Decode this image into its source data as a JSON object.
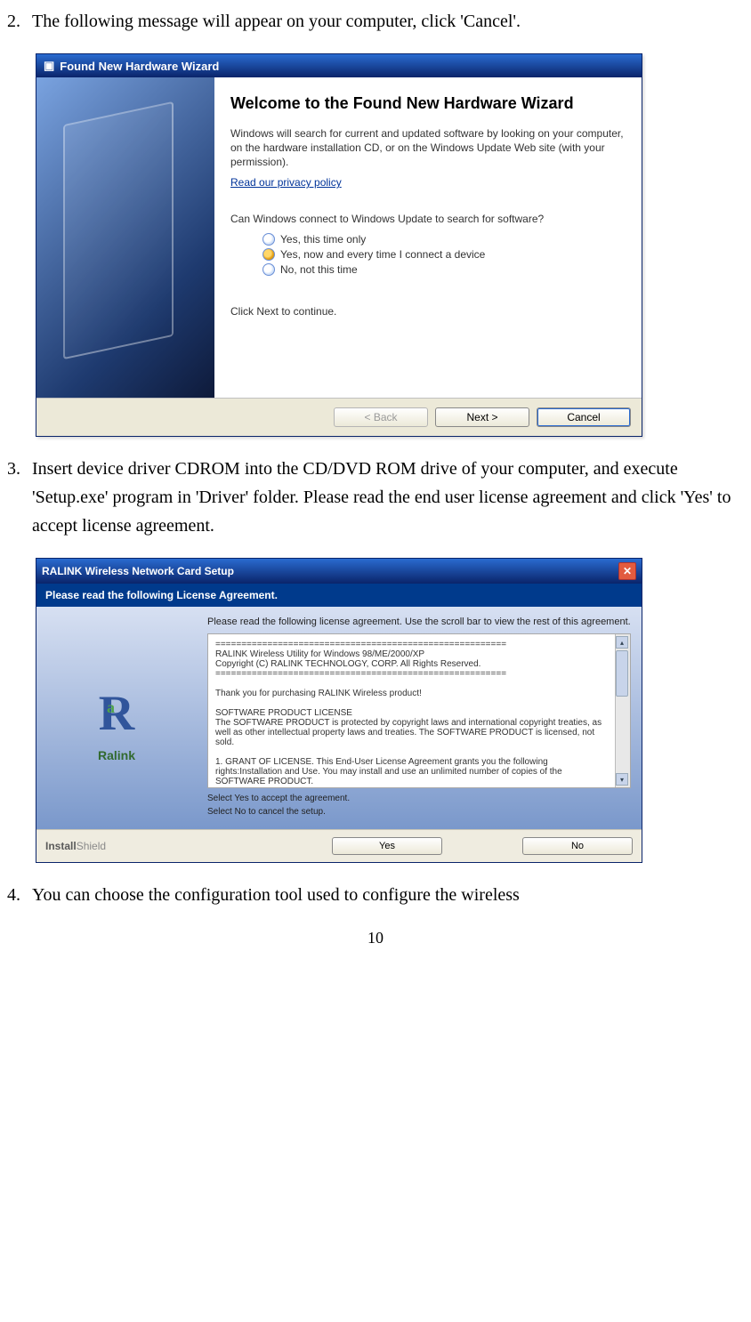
{
  "page_number": "10",
  "steps": {
    "s2": {
      "num": "2.",
      "text": "The following message will appear on your computer, click 'Cancel'."
    },
    "s3": {
      "num": "3.",
      "text": "Insert device driver CDROM into the CD/DVD ROM drive of your computer, and execute 'Setup.exe' program in 'Driver' folder. Please read the end user license agreement and click 'Yes' to accept license agreement."
    },
    "s4": {
      "num": "4.",
      "text": "You can choose the configuration tool used to configure the wireless"
    }
  },
  "dlg1": {
    "title": "Found New Hardware Wizard",
    "heading": "Welcome to the Found New Hardware Wizard",
    "para1": "Windows will search for current and updated software by looking on your computer, on the hardware installation CD, or on the Windows Update Web site (with your permission).",
    "privacy": "Read our privacy policy",
    "question": "Can Windows connect to Windows Update to search for software?",
    "radios": {
      "r1": "Yes, this time only",
      "r2": "Yes, now and every time I connect a device",
      "r3": "No, not this time"
    },
    "continue": "Click Next to continue.",
    "buttons": {
      "back": "< Back",
      "next": "Next >",
      "cancel": "Cancel"
    }
  },
  "dlg2": {
    "title": "RALINK Wireless Network Card Setup",
    "subtitle": "Please read the following License Agreement.",
    "logo_text": "Ralink",
    "intro": "Please read the following license agreement. Use the scroll bar to view the rest of this agreement.",
    "license_text": "========================================================\nRALINK Wireless Utility for Windows 98/ME/2000/XP\nCopyright (C) RALINK TECHNOLOGY, CORP. All Rights Reserved.\n========================================================\n\nThank you for purchasing RALINK Wireless product!\n\nSOFTWARE PRODUCT LICENSE\nThe SOFTWARE PRODUCT is protected by copyright laws and international copyright treaties, as well as other intellectual property laws and treaties. The SOFTWARE PRODUCT is licensed, not sold.\n\n1. GRANT OF LICENSE. This End-User License Agreement grants you the following rights:Installation and Use. You may install and use an unlimited number of copies of the SOFTWARE PRODUCT.\n\nReproduction and Distribution. You may reproduce and distribute an unlimited number of copies of the SOFTWARE PRODUCT; provided that each copy shall be a true and complete",
    "select_yes": "Select Yes to accept the agreement.",
    "select_no": "Select No to cancel the setup.",
    "installshield_a": "Install",
    "installshield_b": "Shield",
    "buttons": {
      "yes": "Yes",
      "no": "No"
    }
  }
}
